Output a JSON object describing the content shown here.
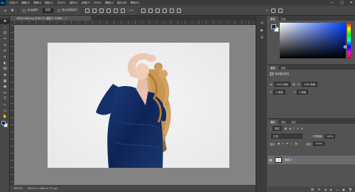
{
  "menubar": {
    "logo": "Ps",
    "items": [
      "文件(F)",
      "编辑(E)",
      "图像(I)",
      "图层(L)",
      "文字(Y)",
      "选择(S)",
      "滤镜(T)",
      "3D(D)",
      "视图(V)",
      "窗口(W)",
      "帮助(H)"
    ],
    "window_controls": [
      "—",
      "□",
      "✕"
    ]
  },
  "optbar": {
    "auto_select_label": "自动选择:",
    "auto_select_value": "图层",
    "show_transform_label": "显示变换控件"
  },
  "document": {
    "tab_title": "1920x1080.png @ 66.7% (图层 0, RGB/8)",
    "tab_close": "×"
  },
  "tools": [
    "✥",
    "⬚",
    "ʘ",
    "✂",
    "⌗",
    "✐",
    "✎",
    "◐",
    "⌧",
    "✚",
    "▦",
    "◉",
    "✍",
    "T",
    "↖",
    "▭",
    "✋",
    "🔍"
  ],
  "statusbar": {
    "zoom": "66.67%",
    "doc_size": "1920 px x 1080 px (72 ppi)"
  },
  "panels": {
    "color_tabs": [
      "颜色",
      "色板"
    ],
    "properties": {
      "tabs": [
        "属性",
        "调整"
      ],
      "layer_type": "像素图层属性",
      "w_label": "W:",
      "w_value": "1920 像素",
      "h_label": "H:",
      "h_value": "1080 像素",
      "x_label": "X:",
      "x_value": "0 像素",
      "y_label": "Y:",
      "y_value": "0 像素"
    },
    "layers": {
      "tabs": [
        "图层",
        "通道",
        "路径"
      ],
      "filter_label": "类型",
      "blend_mode": "正常",
      "opacity_label": "不透明度:",
      "opacity_value": "100%",
      "lock_label": "锁定:",
      "fill_label": "填充:",
      "fill_value": "100%",
      "layer_name": "图层 0",
      "footer_icons": [
        "⛓",
        "fx",
        "◑",
        "◐",
        "▭",
        "▣",
        "🗑"
      ]
    }
  },
  "colors": {
    "foreground": "#0f2f64",
    "background": "#ffffff"
  }
}
